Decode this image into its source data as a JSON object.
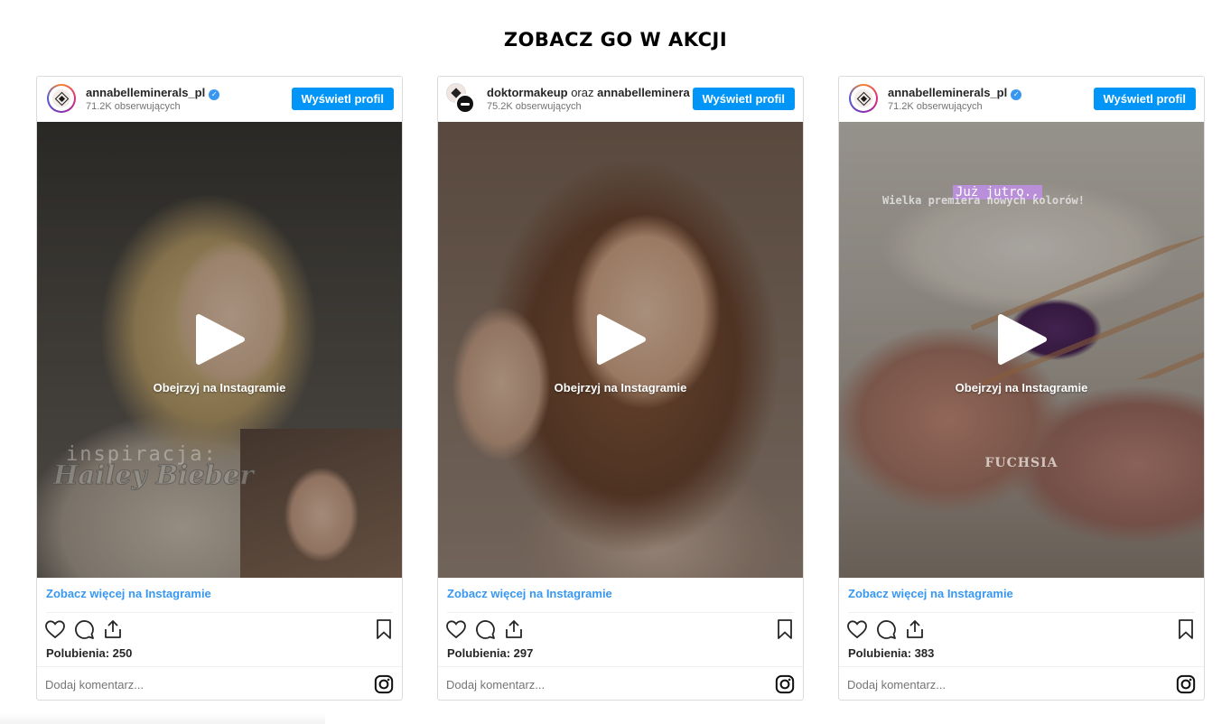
{
  "section": {
    "title": "ZOBACZ GO W AKCJI"
  },
  "posts": [
    {
      "username": "annabelleminerals_pl",
      "collab_word": "",
      "collab_user": "",
      "verified": true,
      "followers": "71.2K obserwujących",
      "profile_button": "Wyświetl profil",
      "watch_label": "Obejrzyj na Instagramie",
      "overlay": [
        "inspiracja:",
        "Hailey Bieber"
      ],
      "see_more": "Zobacz więcej na Instagramie",
      "likes": "Polubienia: 250",
      "comment_placeholder": "Dodaj komentarz..."
    },
    {
      "username": "doktormakeup",
      "collab_word": " oraz ",
      "collab_user": "annabelleminera",
      "verified": false,
      "followers": "75.2K obserwujących",
      "profile_button": "Wyświetl profil",
      "watch_label": "Obejrzyj na Instagramie",
      "overlay": [],
      "see_more": "Zobacz więcej na Instagramie",
      "likes": "Polubienia: 297",
      "comment_placeholder": "Dodaj komentarz..."
    },
    {
      "username": "annabelleminerals_pl",
      "collab_word": "",
      "collab_user": "",
      "verified": true,
      "followers": "71.2K obserwujących",
      "profile_button": "Wyświetl profil",
      "watch_label": "Obejrzyj na Instagramie",
      "overlay": [
        "Już jutro..",
        "Wielka premiera nowych kolorów!",
        "FUCHSIA"
      ],
      "see_more": "Zobacz więcej na Instagramie",
      "likes": "Polubienia: 383",
      "comment_placeholder": "Dodaj komentarz..."
    }
  ],
  "icons": {
    "like": "heart-icon",
    "comment": "comment-icon",
    "share": "share-icon",
    "save": "bookmark-icon",
    "instagram": "instagram-icon",
    "play": "play-icon",
    "verified": "verified-badge-icon"
  },
  "colors": {
    "button": "#0095f6",
    "link": "#3897f0",
    "verified": "#3897f0"
  }
}
